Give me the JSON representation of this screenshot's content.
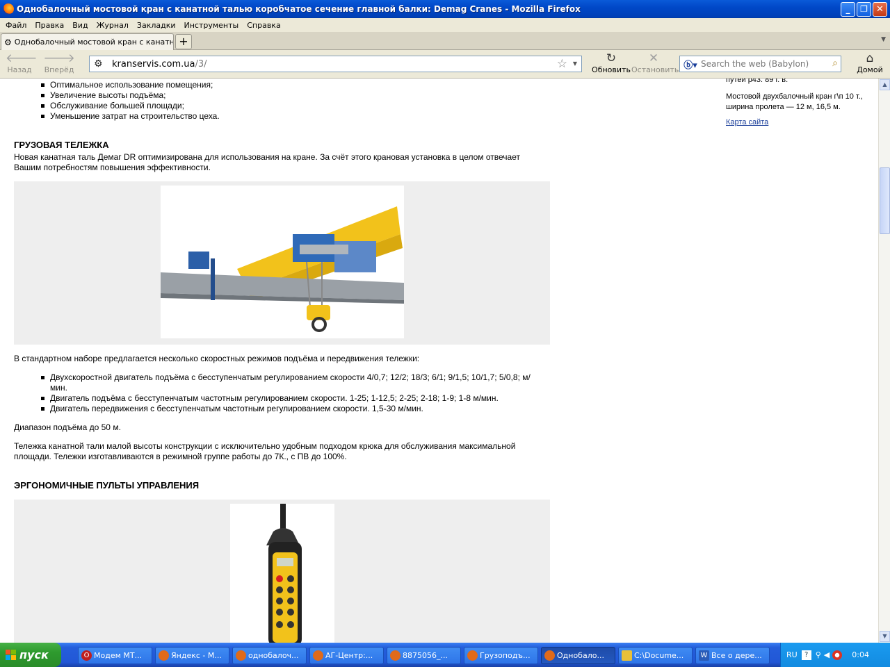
{
  "window": {
    "title": "Однобалочный мостовой кран с канатной талью коробчатое сечение главной балки: Demag Cranes - Mozilla Firefox"
  },
  "menu": [
    "Файл",
    "Правка",
    "Вид",
    "Журнал",
    "Закладки",
    "Инструменты",
    "Справка"
  ],
  "tab": {
    "label": "Однобалочный мостовой кран с канатной..."
  },
  "toolbar": {
    "back_label": "Назад",
    "forward_label": "Вперёд",
    "reload_label": "Обновить",
    "stop_label": "Остановить",
    "home_label": "Домой"
  },
  "address": {
    "host": "kranservis.com.ua",
    "path": "/3/"
  },
  "search": {
    "placeholder": "Search the web (Babylon)"
  },
  "content": {
    "intro_list": [
      "Оптимальное использование помещения;",
      "Увеличение высоты подъёма;",
      "Обслуживание большей площади;",
      "Уменьшение затрат на строительство цеха."
    ],
    "section1_title": "ГРУЗОВАЯ ТЕЛЕЖКА",
    "section1_text": "Новая канатная таль Демаг DR оптимизирована для использования на кране. За счёт этого крановая установка в целом отвечает Вашим потребностям повышения эффективности.",
    "speeds_intro": "В стандартном наборе предлагается несколько скоростных режимов подъёма и передвижения тележки:",
    "speeds_list": [
      "Двухскоростной двигатель подъёма с бесступенчатым регулированием скорости 4/0,7; 12/2; 18/3; 6/1; 9/1,5; 10/1,7; 5/0,8; м/мин.",
      "Двигатель подъёма с бесступенчатым частотным регулированием скорости. 1-25; 1-12,5; 2-25; 2-18; 1-9; 1-8 м/мин.",
      "Двигатель передвижения с бесступенчатым частотным регулированием скорости. 1,5-30 м/мин."
    ],
    "range_text": "Диапазон подъёма до 50 м.",
    "trolley_text": "Тележка канатной тали малой высоты конструкции с исключительно удобным подходом крюка для обслуживания максимальной площади. Тележки изготавливаются в режимной группе работы до 7К., с ПВ до 100%.",
    "section2_title": "ЭРГОНОМИЧНЫЕ ПУЛЬТЫ УПРАВЛЕНИЯ"
  },
  "sidebar": {
    "partial_text": "путей р43. 89 г. в.",
    "item_text": "Мостовой двухбалочный кран г\\п 10 т., ширина пролета — 12 м, 16,5 м.",
    "sitemap_link": "Карта сайта"
  },
  "taskbar": {
    "start_label": "пуск",
    "items": [
      "Модем МТ...",
      "Яндекс - М...",
      "однобалоч...",
      "АГ-Центр:...",
      "8875056_...",
      "Грузоподъ...",
      "Однобало...",
      "C:\\Docume...",
      "Все о дере..."
    ],
    "lang": "RU",
    "clock": "0:04"
  }
}
